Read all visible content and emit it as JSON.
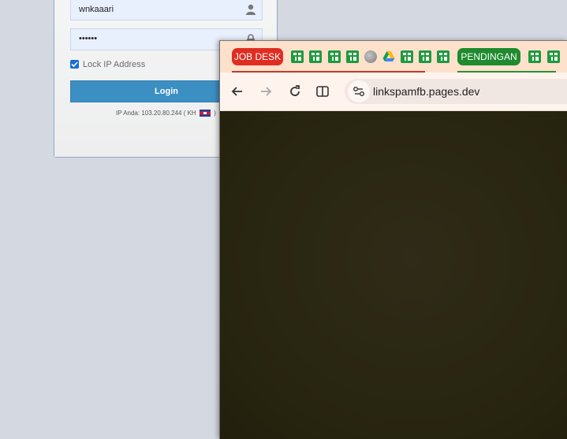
{
  "login": {
    "username_value": "wnkaaari",
    "password_value": "••••••",
    "lock_ip_label": "Lock IP Address",
    "lock_ip_checked": true,
    "login_button": "Login",
    "ip_text": "IP Anda: 103.20.80.244 ( KH",
    "ip_text_end": ")"
  },
  "browser": {
    "bookmarks": {
      "job_desk": "JOB DESK",
      "pendingan": "PENDINGAN",
      "icons": [
        "sheets-icon",
        "sheets-icon",
        "sheets-icon",
        "sheets-icon",
        "globe-icon",
        "google-drive-icon",
        "sheets-icon",
        "sheets-icon",
        "sheets-icon",
        "sheets-icon",
        "sheets-icon"
      ]
    },
    "url": "linkspamfb.pages.dev",
    "colors": {
      "bookmark_bar": "#fde1cb",
      "job_desk": "#e02d22",
      "pendingan": "#1f8a2e",
      "page_bg": "#2a2715"
    }
  }
}
